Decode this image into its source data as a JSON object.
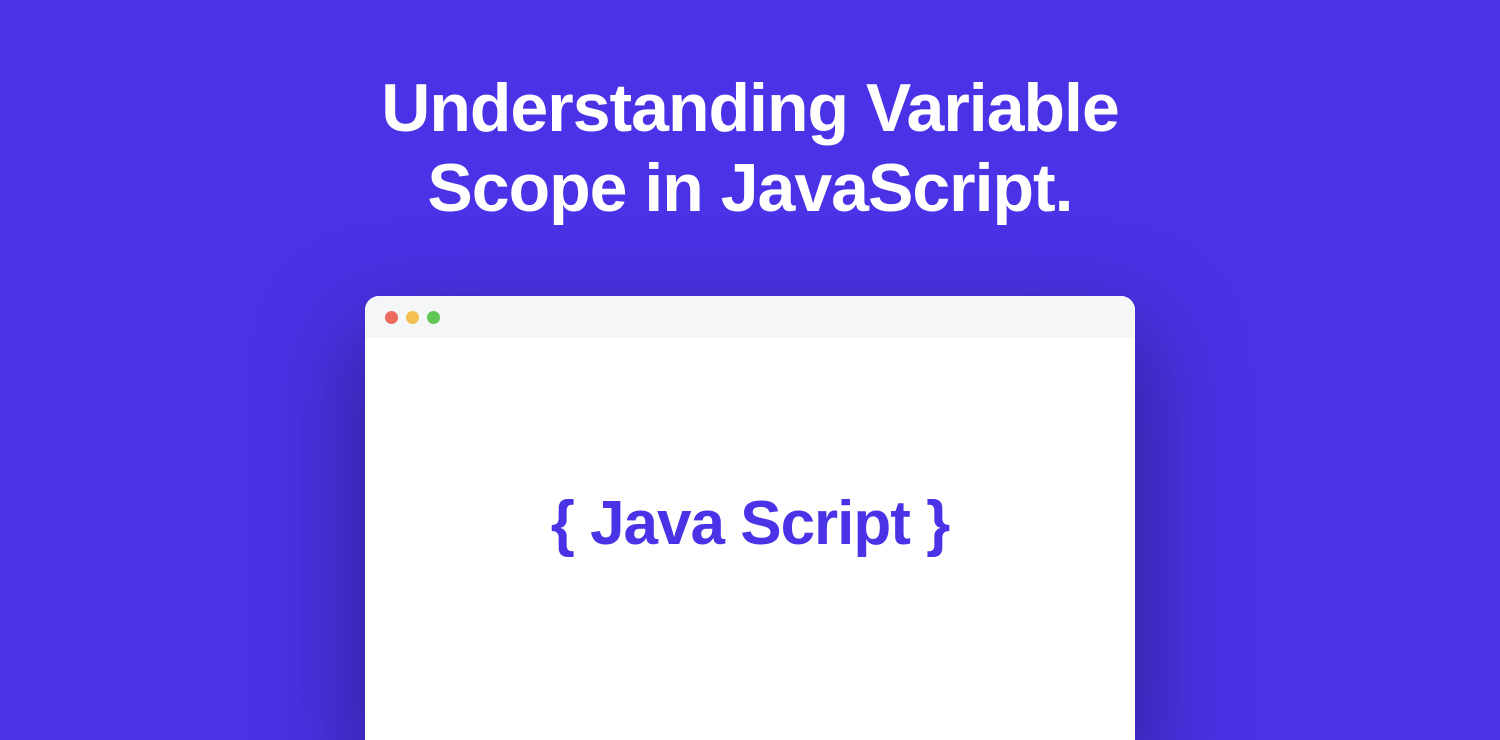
{
  "header": {
    "title": "Understanding Variable Scope in JavaScript."
  },
  "window": {
    "hero_open": "{",
    "hero_text": "Java Script",
    "hero_close": "}"
  },
  "colors": {
    "background": "#4a32e6",
    "window_bg": "#ffffff",
    "titlebar_bg": "#f5f6f8",
    "close": "#ed6a5e",
    "minimize": "#f4bf4f",
    "expand": "#62c654",
    "accent": "#4a32e6"
  }
}
